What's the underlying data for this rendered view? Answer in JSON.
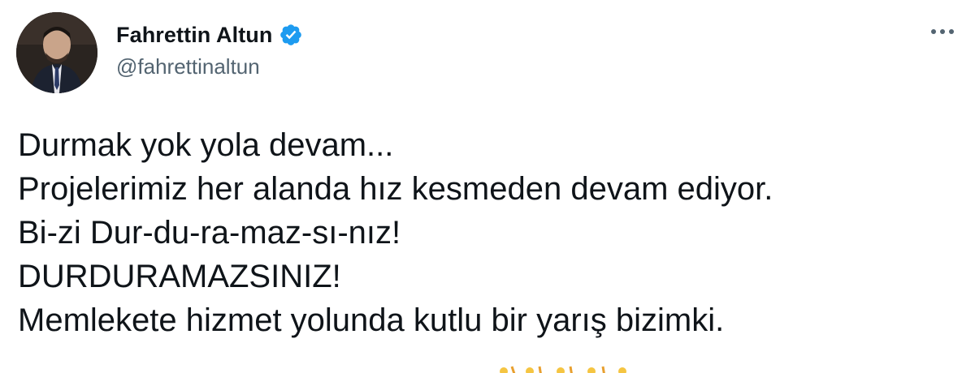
{
  "author": {
    "display_name": "Fahrettin Altun",
    "handle": "@fahrettinaltun",
    "verified": true,
    "avatar_icon": "profile-photo"
  },
  "actions": {
    "more_icon": "more-horizontal-icon"
  },
  "tweet": {
    "lines": [
      "Durmak yok yola devam...",
      "Projelerimiz her alanda hız kesmeden devam ediyor.",
      "Bi-zi Dur-du-ra-maz-sı-nız!",
      "DURDURAMAZSINIZ!",
      "Memlekete hizmet yolunda kutlu bir yarış bizimki."
    ]
  },
  "colors": {
    "verified_badge": "#1d9bf0",
    "secondary_text": "#536471",
    "primary_text": "#0f1419"
  }
}
